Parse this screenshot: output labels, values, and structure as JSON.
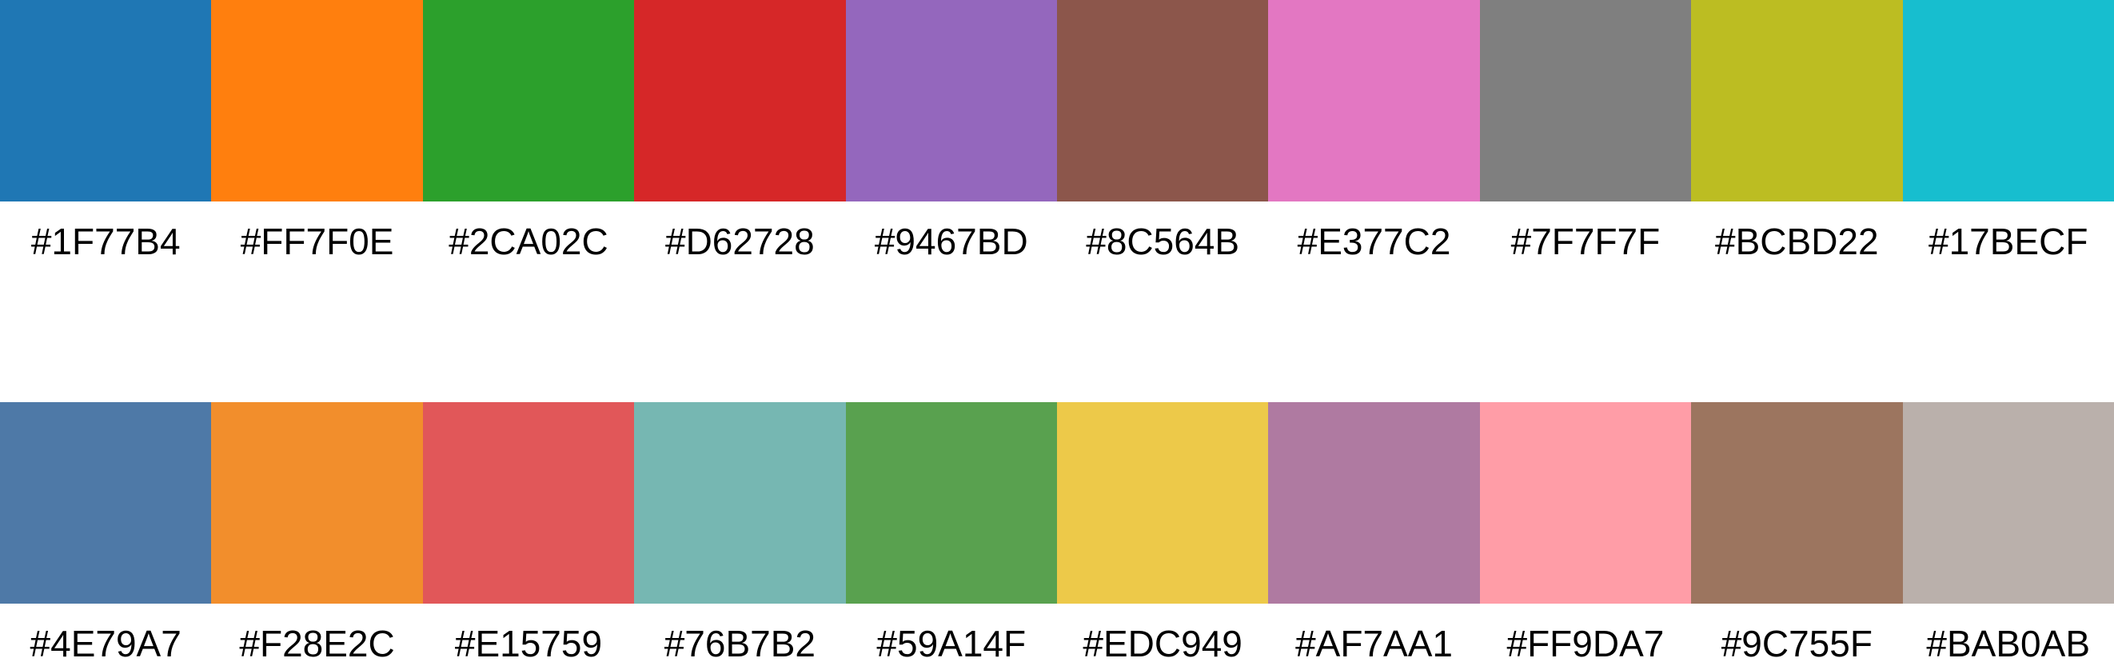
{
  "palette": {
    "row1": [
      {
        "label": "#1F77B4",
        "color": "#1F77B4"
      },
      {
        "label": "#FF7F0E",
        "color": "#FF7F0E"
      },
      {
        "label": "#2CA02C",
        "color": "#2CA02C"
      },
      {
        "label": "#D62728",
        "color": "#D62728"
      },
      {
        "label": "#9467BD",
        "color": "#9467BD"
      },
      {
        "label": "#8C564B",
        "color": "#8C564B"
      },
      {
        "label": "#E377C2",
        "color": "#E377C2"
      },
      {
        "label": "#7F7F7F",
        "color": "#7F7F7F"
      },
      {
        "label": "#BCBD22",
        "color": "#BCBD22"
      },
      {
        "label": "#17BECF",
        "color": "#17BECF"
      }
    ],
    "row2": [
      {
        "label": "#4E79A7",
        "color": "#4E79A7"
      },
      {
        "label": "#F28E2C",
        "color": "#F28E2C"
      },
      {
        "label": "#E15759",
        "color": "#E15759"
      },
      {
        "label": "#76B7B2",
        "color": "#76B7B2"
      },
      {
        "label": "#59A14F",
        "color": "#59A14F"
      },
      {
        "label": "#EDC949",
        "color": "#EDC949"
      },
      {
        "label": "#AF7AA1",
        "color": "#AF7AA1"
      },
      {
        "label": "#FF9DA7",
        "color": "#FF9DA7"
      },
      {
        "label": "#9C755F",
        "color": "#9C755F"
      },
      {
        "label": "#BAB0AB",
        "color": "#BAB0AB"
      }
    ]
  }
}
